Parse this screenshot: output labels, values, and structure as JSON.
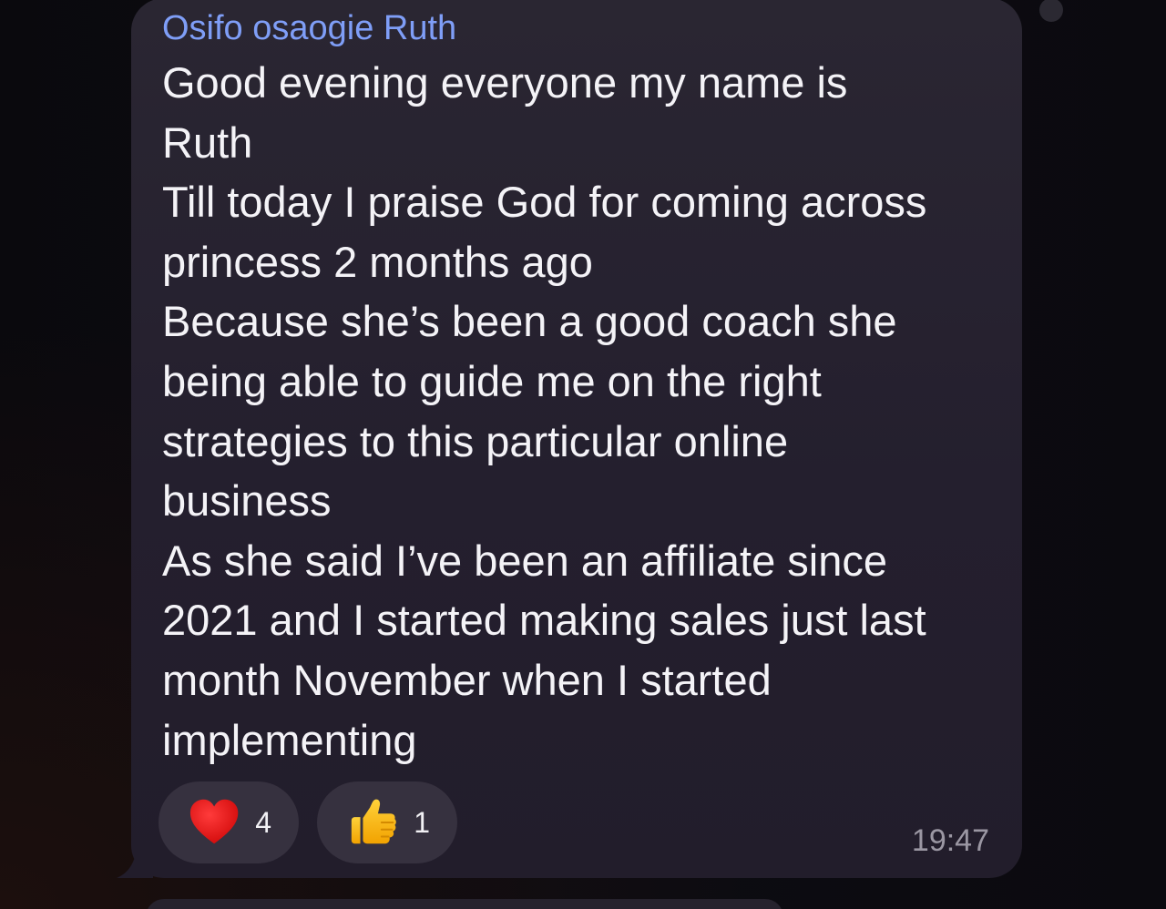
{
  "message": {
    "sender": "Osifo osaogie Ruth",
    "lines": [
      "Good evening everyone my name is",
      "Ruth",
      "Till today I praise God for coming across",
      "princess 2 months ago",
      "Because she’s been a good coach she",
      "being able to guide me on the right",
      "strategies to this particular online",
      "business",
      "As she said I’ve been an affiliate since",
      "2021 and I started making sales just last",
      "month November when I started",
      "implementing"
    ],
    "time": "19:47",
    "reactions": [
      {
        "emoji": "heart-emoji",
        "count": "4"
      },
      {
        "emoji": "thumbs-up-emoji",
        "count": "1"
      }
    ]
  },
  "colors": {
    "sender": "#7f9ef7",
    "bubble": "#262130",
    "text": "#f4f3f7",
    "reaction_pill": "#36313f",
    "timestamp": "#9b97a3"
  }
}
